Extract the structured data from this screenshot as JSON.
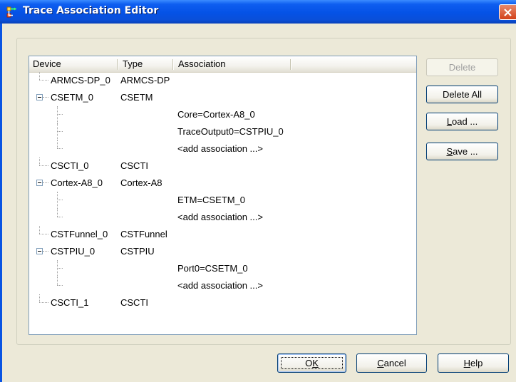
{
  "window": {
    "title": "Trace Association Editor"
  },
  "colors": {
    "titlebar": "#0552e6",
    "face": "#ece9d8",
    "close": "#d2411a",
    "list_border": "#7f9db9"
  },
  "icons": {
    "app": "trace-association-icon",
    "close": "close-icon",
    "expander": "minus-box-icon"
  },
  "table": {
    "columns": [
      "Device",
      "Type",
      "Association"
    ],
    "rows": [
      {
        "device": "ARMCS-DP_0",
        "type": "ARMCS-DP",
        "association": ""
      },
      {
        "device": "CSETM_0",
        "type": "CSETM",
        "association": "",
        "expanded": true
      },
      {
        "device": "",
        "type": "",
        "association": "Core=Cortex-A8_0"
      },
      {
        "device": "",
        "type": "",
        "association": "TraceOutput0=CSTPIU_0"
      },
      {
        "device": "",
        "type": "",
        "association": "<add association ...>"
      },
      {
        "device": "CSCTI_0",
        "type": "CSCTI",
        "association": ""
      },
      {
        "device": "Cortex-A8_0",
        "type": "Cortex-A8",
        "association": "",
        "expanded": true
      },
      {
        "device": "",
        "type": "",
        "association": "ETM=CSETM_0"
      },
      {
        "device": "",
        "type": "",
        "association": "<add association ...>"
      },
      {
        "device": "CSTFunnel_0",
        "type": "CSTFunnel",
        "association": ""
      },
      {
        "device": "CSTPIU_0",
        "type": "CSTPIU",
        "association": "",
        "expanded": true
      },
      {
        "device": "",
        "type": "",
        "association": "Port0=CSETM_0"
      },
      {
        "device": "",
        "type": "",
        "association": "<add association ...>"
      },
      {
        "device": "CSCTI_1",
        "type": "CSCTI",
        "association": ""
      }
    ]
  },
  "side_buttons": {
    "delete": "Delete",
    "delete_all": "Delete All",
    "load": "Load ...",
    "save": "Save ..."
  },
  "footer_buttons": {
    "ok": "OK",
    "cancel": "Cancel",
    "help": "Help"
  }
}
